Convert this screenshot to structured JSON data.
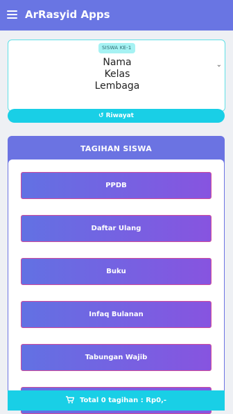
{
  "app": {
    "title": "ArRasyid Apps"
  },
  "student": {
    "badge": "SISWA KE-1",
    "name": "Nama",
    "class": "Kelas",
    "institution": "Lembaga"
  },
  "history_button": {
    "label": "Riwayat"
  },
  "bills": {
    "title": "TAGIHAN SISWA",
    "items": [
      {
        "label": "PPDB"
      },
      {
        "label": "Daftar Ulang"
      },
      {
        "label": "Buku"
      },
      {
        "label": "Infaq Bulanan"
      },
      {
        "label": "Tabungan Wajib"
      },
      {
        "label": ""
      }
    ]
  },
  "footer": {
    "total_label": "Total 0 tagihan : Rp0,-"
  },
  "colors": {
    "appbar": "#6975e3",
    "accent_cyan": "#19cfe6",
    "gradient_start": "#6271e3",
    "gradient_end": "#8754e0"
  }
}
